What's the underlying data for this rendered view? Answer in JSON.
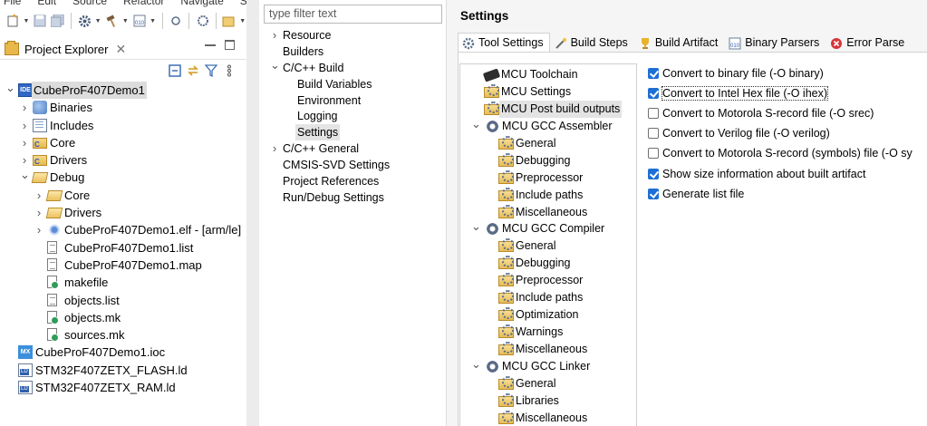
{
  "menubar": [
    "File",
    "Edit",
    "Source",
    "Refactor",
    "Navigate",
    "Sear"
  ],
  "project_explorer": {
    "title": "Project Explorer",
    "tree": [
      {
        "label": "CubeProF407Demo1",
        "indent": 0,
        "twisty": "open",
        "icon": "ide-project",
        "selected": true
      },
      {
        "label": "Binaries",
        "indent": 1,
        "twisty": "closed",
        "icon": "binaries"
      },
      {
        "label": "Includes",
        "indent": 1,
        "twisty": "closed",
        "icon": "includes"
      },
      {
        "label": "Core",
        "indent": 1,
        "twisty": "closed",
        "icon": "source-folder"
      },
      {
        "label": "Drivers",
        "indent": 1,
        "twisty": "closed",
        "icon": "source-folder"
      },
      {
        "label": "Debug",
        "indent": 1,
        "twisty": "open",
        "icon": "folder-open"
      },
      {
        "label": "Core",
        "indent": 2,
        "twisty": "closed",
        "icon": "folder-open"
      },
      {
        "label": "Drivers",
        "indent": 2,
        "twisty": "closed",
        "icon": "folder-open"
      },
      {
        "label": "CubeProF407Demo1.elf - [arm/le]",
        "indent": 2,
        "twisty": "closed",
        "icon": "elf"
      },
      {
        "label": "CubeProF407Demo1.list",
        "indent": 2,
        "twisty": "none",
        "icon": "file"
      },
      {
        "label": "CubeProF407Demo1.map",
        "indent": 2,
        "twisty": "none",
        "icon": "file"
      },
      {
        "label": "makefile",
        "indent": 2,
        "twisty": "none",
        "icon": "makefile"
      },
      {
        "label": "objects.list",
        "indent": 2,
        "twisty": "none",
        "icon": "file"
      },
      {
        "label": "objects.mk",
        "indent": 2,
        "twisty": "none",
        "icon": "makefile"
      },
      {
        "label": "sources.mk",
        "indent": 2,
        "twisty": "none",
        "icon": "makefile"
      },
      {
        "label": "CubeProF407Demo1.ioc",
        "indent": 0,
        "twisty": "none",
        "icon": "mx"
      },
      {
        "label": "STM32F407ZETX_FLASH.ld",
        "indent": 0,
        "twisty": "none",
        "icon": "ld"
      },
      {
        "label": "STM32F407ZETX_RAM.ld",
        "indent": 0,
        "twisty": "none",
        "icon": "ld"
      }
    ]
  },
  "dialog": {
    "filter_placeholder": "type filter text",
    "nav": [
      {
        "label": "Resource",
        "indent": 0,
        "twisty": "closed"
      },
      {
        "label": "Builders",
        "indent": 0,
        "twisty": "none"
      },
      {
        "label": "C/C++ Build",
        "indent": 0,
        "twisty": "open"
      },
      {
        "label": "Build Variables",
        "indent": 1,
        "twisty": "none"
      },
      {
        "label": "Environment",
        "indent": 1,
        "twisty": "none"
      },
      {
        "label": "Logging",
        "indent": 1,
        "twisty": "none"
      },
      {
        "label": "Settings",
        "indent": 1,
        "twisty": "none",
        "selected": true
      },
      {
        "label": "C/C++ General",
        "indent": 0,
        "twisty": "closed"
      },
      {
        "label": "CMSIS-SVD Settings",
        "indent": 0,
        "twisty": "none"
      },
      {
        "label": "Project References",
        "indent": 0,
        "twisty": "none"
      },
      {
        "label": "Run/Debug Settings",
        "indent": 0,
        "twisty": "none"
      }
    ],
    "settings_title": "Settings",
    "tabs": [
      {
        "label": "Tool Settings",
        "icon": "gear-icon",
        "active": true
      },
      {
        "label": "Build Steps",
        "icon": "wand-icon"
      },
      {
        "label": "Build Artifact",
        "icon": "trophy-icon"
      },
      {
        "label": "Binary Parsers",
        "icon": "binary-icon"
      },
      {
        "label": "Error Parse",
        "icon": "error-icon"
      }
    ],
    "tool_tree": [
      {
        "label": "MCU Toolchain",
        "indent": 1,
        "twisty": "none",
        "icon": "chip"
      },
      {
        "label": "MCU Settings",
        "indent": 1,
        "twisty": "none",
        "icon": "option"
      },
      {
        "label": "MCU Post build outputs",
        "indent": 1,
        "twisty": "none",
        "icon": "option",
        "selected": true
      },
      {
        "label": "MCU GCC Assembler",
        "indent": 0,
        "twisty": "open",
        "icon": "tool"
      },
      {
        "label": "General",
        "indent": 2,
        "twisty": "none",
        "icon": "option"
      },
      {
        "label": "Debugging",
        "indent": 2,
        "twisty": "none",
        "icon": "option"
      },
      {
        "label": "Preprocessor",
        "indent": 2,
        "twisty": "none",
        "icon": "option"
      },
      {
        "label": "Include paths",
        "indent": 2,
        "twisty": "none",
        "icon": "option"
      },
      {
        "label": "Miscellaneous",
        "indent": 2,
        "twisty": "none",
        "icon": "option"
      },
      {
        "label": "MCU GCC Compiler",
        "indent": 0,
        "twisty": "open",
        "icon": "tool"
      },
      {
        "label": "General",
        "indent": 2,
        "twisty": "none",
        "icon": "option"
      },
      {
        "label": "Debugging",
        "indent": 2,
        "twisty": "none",
        "icon": "option"
      },
      {
        "label": "Preprocessor",
        "indent": 2,
        "twisty": "none",
        "icon": "option"
      },
      {
        "label": "Include paths",
        "indent": 2,
        "twisty": "none",
        "icon": "option"
      },
      {
        "label": "Optimization",
        "indent": 2,
        "twisty": "none",
        "icon": "option"
      },
      {
        "label": "Warnings",
        "indent": 2,
        "twisty": "none",
        "icon": "option"
      },
      {
        "label": "Miscellaneous",
        "indent": 2,
        "twisty": "none",
        "icon": "option"
      },
      {
        "label": "MCU GCC Linker",
        "indent": 0,
        "twisty": "open",
        "icon": "tool"
      },
      {
        "label": "General",
        "indent": 2,
        "twisty": "none",
        "icon": "option"
      },
      {
        "label": "Libraries",
        "indent": 2,
        "twisty": "none",
        "icon": "option"
      },
      {
        "label": "Miscellaneous",
        "indent": 2,
        "twisty": "none",
        "icon": "option"
      }
    ],
    "options": [
      {
        "label": "Convert to binary file (-O binary)",
        "checked": true
      },
      {
        "label": "Convert to Intel Hex file (-O ihex)",
        "checked": true,
        "focused": true
      },
      {
        "label": "Convert to Motorola S-record file (-O srec)",
        "checked": false
      },
      {
        "label": "Convert to Verilog file (-O verilog)",
        "checked": false
      },
      {
        "label": "Convert to Motorola S-record (symbols) file (-O sy",
        "checked": false
      },
      {
        "label": "Show size information about built artifact",
        "checked": true
      },
      {
        "label": "Generate list file",
        "checked": true
      }
    ]
  },
  "colors": {
    "accent": "#1d6fd6",
    "selection": "#dcdcdc",
    "panel": "#f5f5f5"
  }
}
